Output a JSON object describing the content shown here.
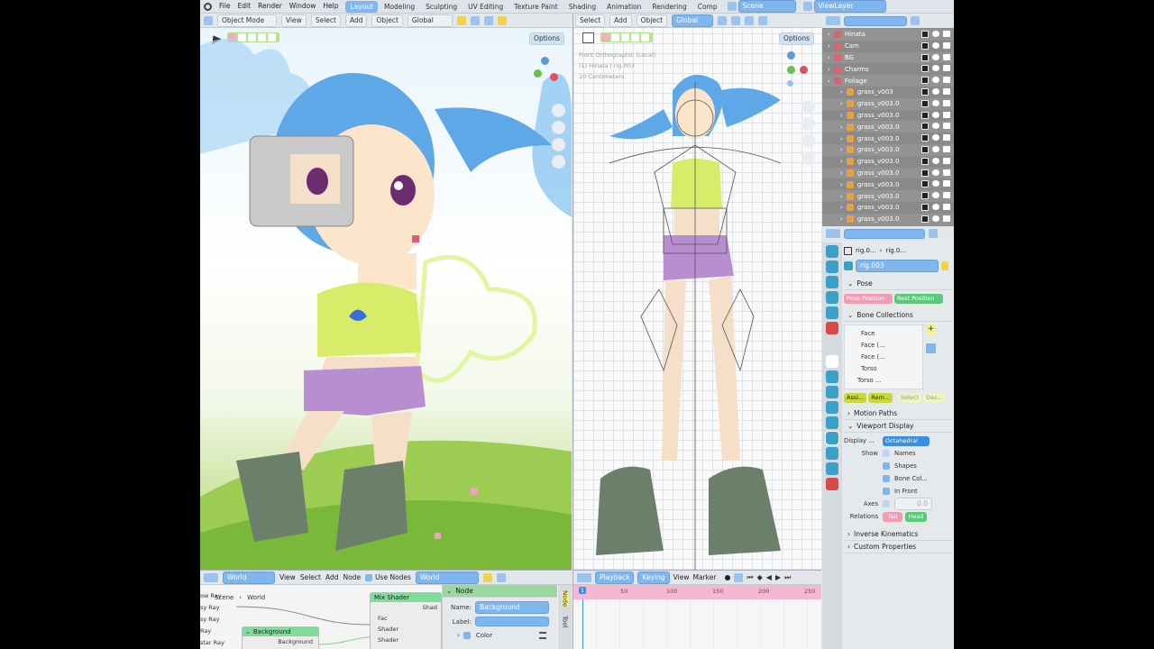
{
  "topbar": {
    "menus": [
      "File",
      "Edit",
      "Render",
      "Window",
      "Help"
    ],
    "workspaces": [
      "Layout",
      "Modeling",
      "Sculpting",
      "UV Editing",
      "Texture Paint",
      "Shading",
      "Animation",
      "Rendering",
      "Comp"
    ],
    "scene": "Scene",
    "view_layer": "ViewLayer"
  },
  "viewport_left": {
    "mode": "Object Mode",
    "menus": [
      "View",
      "Select",
      "Add",
      "Object"
    ],
    "orientation": "Global",
    "options": "Options"
  },
  "viewport_right": {
    "menus": [
      "Select",
      "Add",
      "Object"
    ],
    "orientation": "Global",
    "options": "Options",
    "overlay_title": "Front Orthographic (Local)",
    "overlay_object": "(1) Hinata | rig.003",
    "overlay_scale": "10 Centimeters"
  },
  "outliner": {
    "rows": [
      {
        "label": "Hinata",
        "depth": 0,
        "color": "#d9646d"
      },
      {
        "label": "Cam",
        "depth": 0,
        "color": "#d9646d"
      },
      {
        "label": "BG",
        "depth": 0,
        "color": "#d9646d"
      },
      {
        "label": "Charms",
        "depth": 0,
        "color": "#d9646d"
      },
      {
        "label": "Foliage",
        "depth": 0,
        "color": "#d9646d"
      },
      {
        "label": "grass_v003",
        "depth": 1,
        "color": "#e8a048"
      },
      {
        "label": "grass_v003.0",
        "depth": 1,
        "color": "#e8a048"
      },
      {
        "label": "grass_v003.0",
        "depth": 1,
        "color": "#e8a048"
      },
      {
        "label": "grass_v003.0",
        "depth": 1,
        "color": "#e8a048"
      },
      {
        "label": "grass_v003.0",
        "depth": 1,
        "color": "#e8a048"
      },
      {
        "label": "grass_v003.0",
        "depth": 1,
        "color": "#e8a048"
      },
      {
        "label": "grass_v003.0",
        "depth": 1,
        "color": "#e8a048"
      },
      {
        "label": "grass_v003.0",
        "depth": 1,
        "color": "#e8a048"
      },
      {
        "label": "grass_v003.0",
        "depth": 1,
        "color": "#e8a048"
      },
      {
        "label": "grass_v003.0",
        "depth": 1,
        "color": "#e8a048"
      },
      {
        "label": "grass_v003.0",
        "depth": 1,
        "color": "#e8a048"
      },
      {
        "label": "grass_v003.0",
        "depth": 1,
        "color": "#e8a048"
      }
    ]
  },
  "properties": {
    "breadcrumb": [
      "rig.0...",
      "rig.0..."
    ],
    "armature_name": "rig.003",
    "pose": {
      "title": "Pose",
      "pose_position": "Pose Position",
      "rest_position": "Rest Position"
    },
    "bone_collections": {
      "title": "Bone Collections",
      "items": [
        "Face",
        "Face (...",
        "Face (...",
        "Torso",
        "Torso ..."
      ],
      "assign": "Assi...",
      "remove": "Rem...",
      "select": "Select",
      "deselect": "Des..."
    },
    "motion_paths": "Motion Paths",
    "viewport_display": {
      "title": "Viewport Display",
      "display_as_label": "Display ...",
      "display_as_value": "Octahedral",
      "show_label": "Show",
      "names": "Names",
      "shapes": "Shapes",
      "bone_colors": "Bone Col...",
      "in_front": "In Front",
      "axes_label": "Axes",
      "axes_value": "0.0",
      "relations_label": "Relations",
      "tail": "Tail",
      "head": "Head"
    },
    "inverse_kinematics": "Inverse Kinematics",
    "custom_properties": "Custom Properties"
  },
  "node_editor": {
    "world_select": "World",
    "menus": [
      "View",
      "Select",
      "Add",
      "Node"
    ],
    "use_nodes": "Use Nodes",
    "world_name": "World",
    "breadcrumb_scene": "Scene",
    "breadcrumb_world": "World",
    "left_labels": [
      "ow Ray",
      "sy Ray",
      "sy Ray",
      "Ray",
      "star Ray",
      "son Ray"
    ],
    "mix_shader": "Mix Shader",
    "mix_out": "Shad",
    "mix_inputs": [
      "Fac",
      "Shader",
      "Shader"
    ],
    "background_node": "Background",
    "background_out": "Background",
    "side_panel": {
      "title": "Node",
      "name_label": "Name:",
      "name_value": "Background",
      "label_label": "Label:",
      "color_label": "Color",
      "tabs": [
        "Node",
        "Tool"
      ]
    }
  },
  "timeline": {
    "playback": "Playback",
    "keying": "Keying",
    "view": "View",
    "marker": "Marker",
    "current_frame": "1",
    "ticks": [
      "50",
      "100",
      "150",
      "200",
      "250"
    ]
  }
}
